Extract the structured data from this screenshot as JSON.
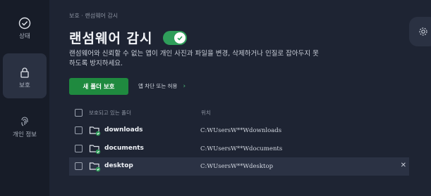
{
  "sidebar": {
    "items": [
      {
        "label": "상태",
        "icon": "check-circle-icon"
      },
      {
        "label": "보호",
        "icon": "lock-icon"
      },
      {
        "label": "개인 정보",
        "icon": "fingerprint-icon"
      }
    ]
  },
  "breadcrumb": "보호 · 랜섬웨어 감시",
  "title": "랜섬웨어 감시",
  "toggle": {
    "on": true
  },
  "description": "랜섬웨어와 신뢰할 수 없는 앱이 개인 사진과 파일을 변경, 삭제하거나 인질로 잡아두지 못하도록 방지하세요.",
  "buttons": {
    "protect_folder": "새 폴더 보호",
    "block_allow_apps": "앱 차단 또는 허용"
  },
  "table": {
    "headers": [
      "보호되고 있는 폴더",
      "위치"
    ],
    "rows": [
      {
        "name": "downloads",
        "path": "C:WUsersW**Wdownloads"
      },
      {
        "name": "documents",
        "path": "C:WUsersW**Wdocuments"
      },
      {
        "name": "desktop",
        "path": "C:WUsersW**Wdesktop"
      }
    ]
  },
  "colors": {
    "accent": "#2f9e5a",
    "button": "#1f8a3f",
    "background": "#1e2433",
    "sidebar": "#171c28"
  }
}
